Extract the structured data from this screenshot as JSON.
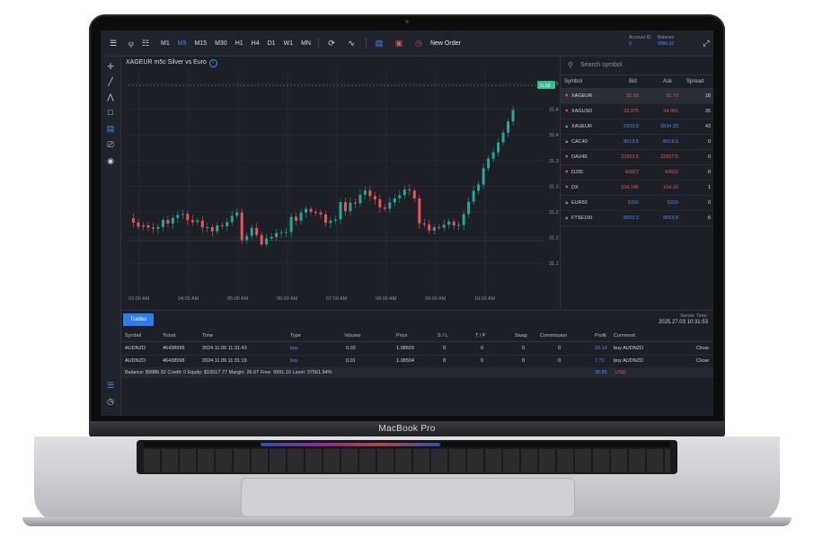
{
  "device": {
    "brand": "MacBook Pro"
  },
  "toolbar": {
    "timeframes": [
      "M1",
      "M5",
      "M15",
      "M30",
      "H1",
      "H4",
      "D1",
      "W1",
      "MN"
    ],
    "active_timeframe": "M5",
    "new_order_label": "New Order",
    "account_label": "Account ID",
    "account_value": "0",
    "balance_label": "Balance",
    "balance_value": "9986.92"
  },
  "chart": {
    "title": "XAGEUR m5c Silver vs Euro",
    "price_tag": "31.56",
    "y_ticks": [
      "31.50",
      "31.450",
      "31.400",
      "31.350",
      "31.300",
      "31.250",
      "31.200",
      "31.150"
    ],
    "x_ticks": [
      "03:00 AM",
      "04:00 AM",
      "05:00 AM",
      "06:00 AM",
      "07:00 AM",
      "08:00 AM",
      "09:00 AM",
      "10:00 AM"
    ]
  },
  "chart_data": {
    "type": "candlestick",
    "title": "XAGEUR m5c Silver vs Euro",
    "x_range": [
      "02:45 AM",
      "10:35 AM"
    ],
    "ylim": [
      31.15,
      31.55
    ],
    "last_price": 31.56,
    "colors": {
      "up": "#26a69a",
      "down": "#ef5350"
    }
  },
  "watchlist": {
    "search_placeholder": "Search symbol",
    "headers": {
      "symbol": "Symbol",
      "bid": "Bid",
      "ask": "Ask",
      "spread": "Spread"
    },
    "rows": [
      {
        "symbol": "XAGEUR",
        "bid": "31.55",
        "ask": "31.73",
        "spread": "18",
        "dir": "down"
      },
      {
        "symbol": "XAGUSD",
        "bid": "33.975",
        "ask": "34.001",
        "spread": "26",
        "dir": "down"
      },
      {
        "symbol": "XAUEUR",
        "bid": "2833.9",
        "ask": "2834.33",
        "spread": "43",
        "dir": "up"
      },
      {
        "symbol": "CAC40",
        "bid": "8013.5",
        "ask": "8016.5",
        "spread": "0",
        "dir": "up"
      },
      {
        "symbol": "DAX40",
        "bid": "22893.5",
        "ask": "22897.5",
        "spread": "0",
        "dir": "down"
      },
      {
        "symbol": "DJ30",
        "bid": "42827",
        "ask": "42832",
        "spread": "0",
        "dir": "down"
      },
      {
        "symbol": "DX",
        "bid": "104.146",
        "ask": "104.16",
        "spread": "1",
        "dir": "down"
      },
      {
        "symbol": "EUR50",
        "bid": "5326",
        "ask": "5329",
        "spread": "0",
        "dir": "up"
      },
      {
        "symbol": "FTSE100",
        "bid": "8652.2",
        "ask": "8653.8",
        "spread": "6",
        "dir": "up"
      }
    ]
  },
  "trades": {
    "tab_label": "Trades",
    "server_time_label": "Server Time:",
    "server_time": "2025.27.03 10:31:53",
    "headers": {
      "symbol": "Symbol",
      "ticket": "Ticket",
      "time": "Time",
      "type": "Type",
      "volume": "Volume",
      "price": "Price",
      "sl": "S / L",
      "tp": "T / P",
      "swap": "Swap",
      "commission": "Commission",
      "profit": "Profit",
      "comment": "Comment"
    },
    "rows": [
      {
        "symbol": "AUDNZD",
        "ticket": "46438999",
        "time": "2024.11.09 11:31:43",
        "type": "buy",
        "volume": "0.03",
        "price": "1.08503",
        "sl": "0",
        "tp": "0",
        "swap": "0",
        "commission": "0",
        "profit": "23.14",
        "comment": "buy AUDNZD",
        "action": "Close"
      },
      {
        "symbol": "AUDNZD",
        "ticket": "46438998",
        "time": "2024.11.09 11:31:19",
        "type": "buy",
        "volume": "0.01",
        "price": "1.08504",
        "sl": "0",
        "tp": "0",
        "swap": "0",
        "commission": "0",
        "profit": "7.71",
        "comment": "buy AUDNZD",
        "action": "Close"
      }
    ],
    "summary": "Balance: $9986.92   Credit: 0   Equity: $10017.77   Margin: 26.67   Free: 9991.10   Level: 37561.94%",
    "total_profit": "30.85",
    "currency": "USD"
  }
}
